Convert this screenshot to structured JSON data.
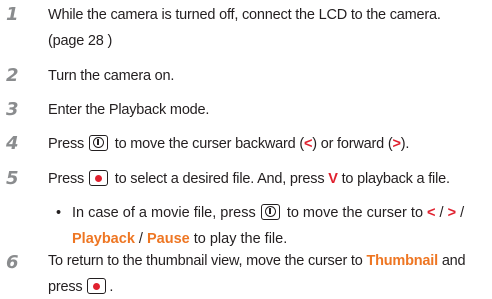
{
  "steps": [
    {
      "number": "1",
      "line1": "While the camera is turned off, connect the LCD to the camera.",
      "line2": "(page 28 )"
    },
    {
      "number": "2",
      "text": "Turn the camera on."
    },
    {
      "number": "3",
      "text": "Enter the Playback mode."
    },
    {
      "number": "4",
      "before": "Press",
      "after": "to move the curser backward (",
      "lt": "<",
      "mid": ") or forward (",
      "gt": ">",
      "end": ")."
    },
    {
      "number": "5",
      "before": "Press",
      "after": "to select a desired file. And, press",
      "v": "V",
      "end": "to playback a file."
    },
    {
      "number": "6",
      "line1a": "To return to the thumbnail view, move the curser to",
      "thumbnail": "Thumbnail",
      "line1b": "and",
      "press": "press",
      "period": "."
    }
  ],
  "bullet": {
    "dot": "•",
    "text1": "In case of a movie file, press",
    "text2": "to move the curser to",
    "lt": "<",
    "slash1": "/",
    "gt": ">",
    "slash2": "/",
    "playback": "Playback",
    "slash3": "/",
    "pause": "Pause",
    "end": "to play the file."
  },
  "icons": {
    "power_button": "power-button-icon",
    "record_button": "record-button-icon"
  },
  "colors": {
    "red": "#e0202e",
    "orange": "#ee7623",
    "step_number": "#8a8c8e"
  }
}
